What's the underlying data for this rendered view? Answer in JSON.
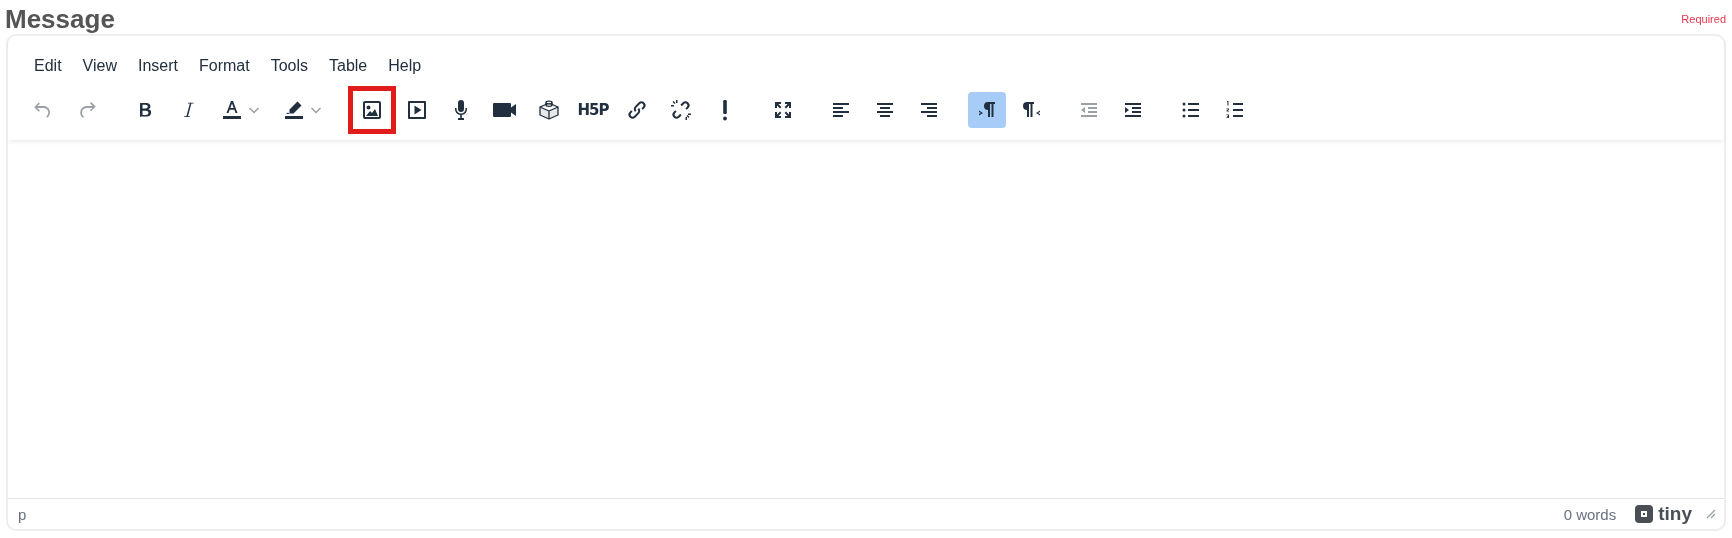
{
  "field": {
    "label": "Message",
    "required": "Required"
  },
  "menubar": [
    {
      "label": "Edit"
    },
    {
      "label": "View"
    },
    {
      "label": "Insert"
    },
    {
      "label": "Format"
    },
    {
      "label": "Tools"
    },
    {
      "label": "Table"
    },
    {
      "label": "Help"
    }
  ],
  "toolbar": [
    [
      {
        "kind": "undo",
        "disabled": true,
        "active": false,
        "highlighted": false
      },
      {
        "kind": "redo",
        "disabled": true,
        "active": false,
        "highlighted": false
      }
    ],
    [
      {
        "kind": "bold",
        "disabled": false,
        "active": false,
        "highlighted": false
      },
      {
        "kind": "italic",
        "disabled": false,
        "active": false,
        "highlighted": false
      },
      {
        "kind": "forecolor",
        "disabled": false,
        "active": false,
        "highlighted": false
      },
      {
        "kind": "backcolor",
        "disabled": false,
        "active": false,
        "highlighted": false
      }
    ],
    [
      {
        "kind": "image",
        "disabled": false,
        "active": false,
        "highlighted": true
      },
      {
        "kind": "media",
        "disabled": false,
        "active": false,
        "highlighted": false
      },
      {
        "kind": "audio",
        "disabled": false,
        "active": false,
        "highlighted": false
      },
      {
        "kind": "video",
        "disabled": false,
        "active": false,
        "highlighted": false
      },
      {
        "kind": "block",
        "disabled": false,
        "active": false,
        "highlighted": false
      },
      {
        "kind": "h5p",
        "text": "H5P",
        "disabled": false,
        "active": false,
        "highlighted": false
      },
      {
        "kind": "link",
        "disabled": false,
        "active": false,
        "highlighted": false
      },
      {
        "kind": "unlink",
        "disabled": false,
        "active": false,
        "highlighted": false
      },
      {
        "kind": "alert",
        "disabled": false,
        "active": false,
        "highlighted": false
      }
    ],
    [
      {
        "kind": "fullscreen",
        "disabled": false,
        "active": false,
        "highlighted": false
      }
    ],
    [
      {
        "kind": "alignleft",
        "disabled": false,
        "active": false,
        "highlighted": false
      },
      {
        "kind": "aligncenter",
        "disabled": false,
        "active": false,
        "highlighted": false
      },
      {
        "kind": "alignright",
        "disabled": false,
        "active": false,
        "highlighted": false
      }
    ],
    [
      {
        "kind": "ltr",
        "disabled": false,
        "active": true,
        "highlighted": false
      },
      {
        "kind": "rtl",
        "disabled": false,
        "active": false,
        "highlighted": false
      }
    ],
    [
      {
        "kind": "outdent",
        "disabled": true,
        "active": false,
        "highlighted": false
      },
      {
        "kind": "indent",
        "disabled": false,
        "active": false,
        "highlighted": false
      }
    ],
    [
      {
        "kind": "bullist",
        "disabled": false,
        "active": false,
        "highlighted": false
      },
      {
        "kind": "numlist",
        "disabled": false,
        "active": false,
        "highlighted": false
      }
    ]
  ],
  "statusbar": {
    "path": "p",
    "wordcount": "0 words",
    "brand": "tiny"
  }
}
